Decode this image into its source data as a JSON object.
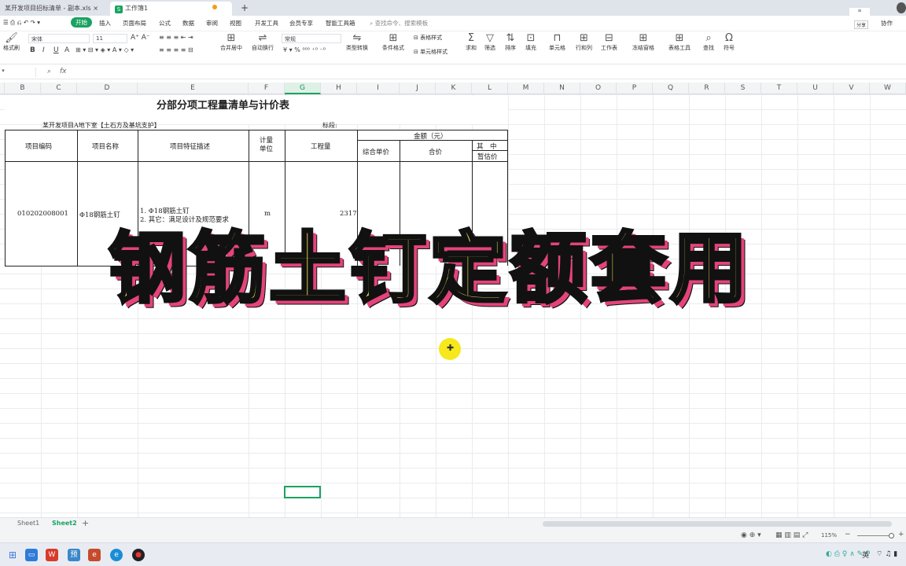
{
  "tabs": [
    {
      "label": "某开发项目招标清单 - 副本.xls",
      "active": false
    },
    {
      "label": "工作簿1",
      "active": true
    }
  ],
  "menu": {
    "items": [
      "开始",
      "插入",
      "页面布局",
      "公式",
      "数据",
      "审阅",
      "视图",
      "开发工具",
      "会员专享",
      "智能工具箱"
    ],
    "search_placeholder": "查找命令、搜索模板",
    "share_label": "分享",
    "collab_label": "协作"
  },
  "ribbon": {
    "paste_label": "格式刷",
    "font_name": "宋体",
    "font_size": "11",
    "merge_label": "合并居中",
    "wrap_label": "自动换行",
    "number_format": "常规",
    "convert_label": "类型转换",
    "cond_label": "条件格式",
    "table_style_label": "表格样式",
    "cell_style_label": "单元格样式",
    "sum_label": "求和",
    "filter_label": "筛选",
    "sort_label": "排序",
    "fill_label": "填充",
    "cell_label": "单元格",
    "rowcol_label": "行和列",
    "sheet_label": "工作表",
    "freeze_label": "冻结窗格",
    "tools_label": "表格工具",
    "find_label": "查找",
    "symbol_label": "符号"
  },
  "formula_bar": {
    "fx": "fx"
  },
  "columns": [
    "B",
    "C",
    "D",
    "E",
    "F",
    "G",
    "H",
    "I",
    "J",
    "K",
    "L",
    "M",
    "N",
    "O",
    "P",
    "Q",
    "R",
    "S",
    "T",
    "U",
    "V",
    "W"
  ],
  "sheet": {
    "title": "分部分项工程量清单与计价表",
    "project_name": "某开发项目A地下室【土石方及基坑支护】",
    "section_label": "标段:",
    "headers": {
      "code": "项目编码",
      "name": "项目名称",
      "desc": "项目特征描述",
      "unit": "计量单位",
      "qty": "工程量",
      "amount": "金额（元）",
      "unit_price": "综合单价",
      "total": "合价",
      "of_which": "其　中",
      "provisional": "暂估价"
    },
    "row": {
      "code": "010202008001",
      "name": "Φ18钢筋土钉",
      "desc_line1": "1. Φ18钢筋土钉",
      "desc_line2": "2. 其它：满足设计及规范要求",
      "unit": "m",
      "qty": "2317"
    }
  },
  "overlay_title": "钢筋土钉定额套用",
  "sheet_tabs": [
    "Sheet1",
    "Sheet2"
  ],
  "status": {
    "zoom": "115%"
  },
  "taskbar": {
    "ime": "英"
  }
}
